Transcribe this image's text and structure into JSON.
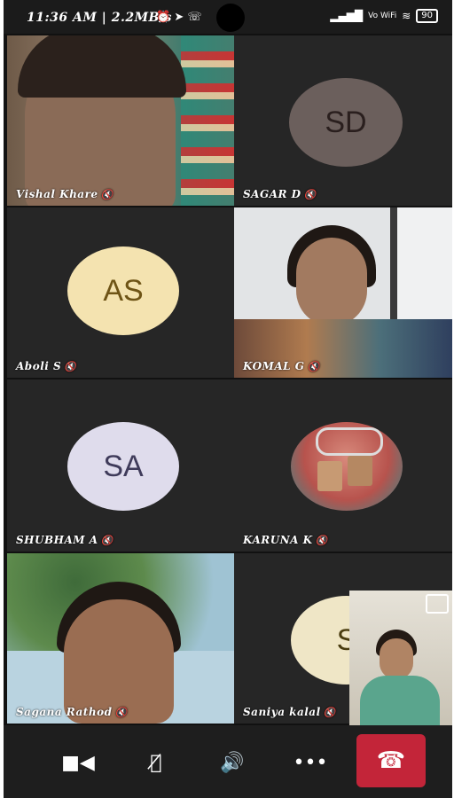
{
  "status_bar": {
    "time": "11:36 AM | 2.2MB/s",
    "network": "Vo WiFi",
    "battery": "90"
  },
  "participants": [
    {
      "name": "Vishal Khare",
      "type": "video"
    },
    {
      "name": "SAGAR D",
      "type": "avatar",
      "initials": "SD",
      "avatar_bg": "#6b5f5c",
      "avatar_fg": "#2a1f1e"
    },
    {
      "name": "Aboli S",
      "type": "avatar",
      "initials": "AS",
      "avatar_bg": "#f4e3b0",
      "avatar_fg": "#6e5416"
    },
    {
      "name": "KOMAL G",
      "type": "video"
    },
    {
      "name": "SHUBHAM A",
      "type": "avatar",
      "initials": "SA",
      "avatar_bg": "#dfdcec",
      "avatar_fg": "#3f3b5a"
    },
    {
      "name": "KARUNA K",
      "type": "image"
    },
    {
      "name": "Sagana Rathod",
      "type": "video"
    },
    {
      "name": "Saniya kalal",
      "type": "avatar",
      "initials": "S",
      "avatar_bg": "#efe6c6",
      "avatar_fg": "#4a3d10"
    }
  ],
  "controls": {
    "camera": "camera-icon",
    "mic": "mic-off-icon",
    "speaker": "speaker-icon",
    "more": "more-icon",
    "leave": "end-call-icon"
  }
}
